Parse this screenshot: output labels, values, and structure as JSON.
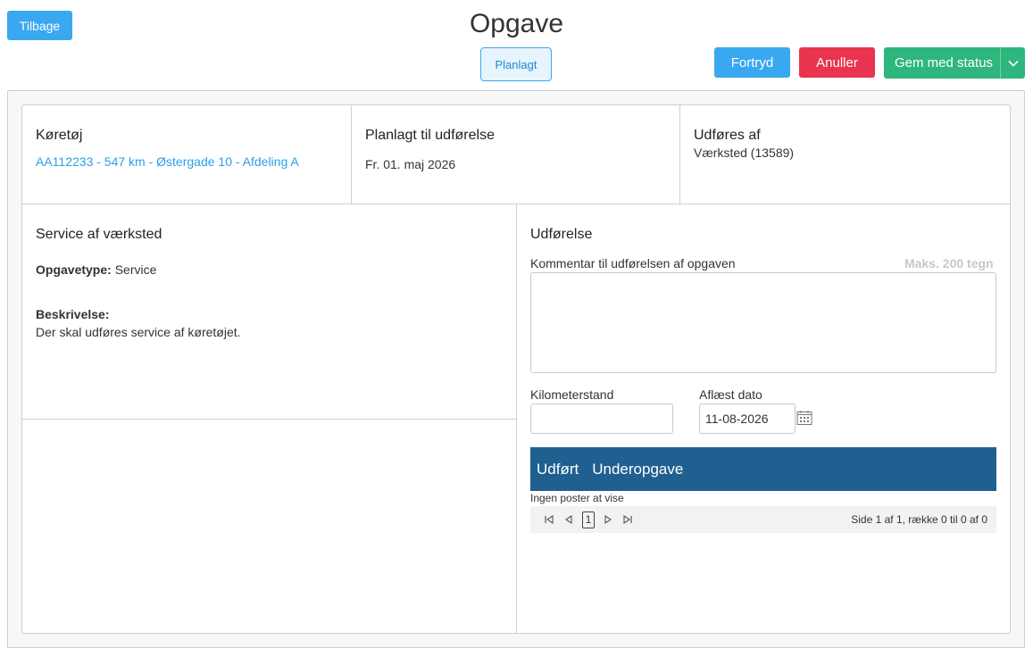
{
  "header": {
    "back_label": "Tilbage",
    "title": "Opgave",
    "status_badge": "Planlagt",
    "undo_label": "Fortryd",
    "cancel_label": "Anuller",
    "save_label": "Gem med status"
  },
  "vehicle": {
    "heading": "Køretøj",
    "link_text": "AA112233 - 547 km - Østergade 10 - Afdeling A"
  },
  "planned": {
    "heading": "Planlagt til udførelse",
    "date": "Fr. 01. maj 2026"
  },
  "performer": {
    "heading": "Udføres af",
    "value": "Værksted (13589)"
  },
  "task": {
    "heading": "Service af værksted",
    "type_label": "Opgavetype:",
    "type_value": "Service",
    "description_label": "Beskrivelse:",
    "description_value": "Der skal udføres service af køretøjet."
  },
  "execution": {
    "heading": "Udførelse",
    "comment_label": "Kommentar til udførelsen af opgaven",
    "comment_max": "Maks. 200 tegn",
    "comment_value": "",
    "km_label": "Kilometerstand",
    "km_value": "",
    "date_label": "Aflæst dato",
    "date_value": "11-08-2026"
  },
  "subtasks": {
    "columns": [
      "Udført",
      "Underopgave"
    ],
    "empty_text": "Ingen poster at vise",
    "current_page": "1",
    "page_info": "Side 1 af 1, række 0 til 0 af 0"
  },
  "icons": {
    "calendar": "calendar-icon",
    "first": "first-page-icon",
    "prev": "prev-page-icon",
    "next": "next-page-icon",
    "last": "last-page-icon",
    "dropdown": "chevron-down-icon"
  },
  "colors": {
    "primary": "#3aa8f0",
    "danger": "#e8344e",
    "success": "#2eb67d",
    "grid_header": "#1f6090",
    "link": "#2a9fe6"
  }
}
